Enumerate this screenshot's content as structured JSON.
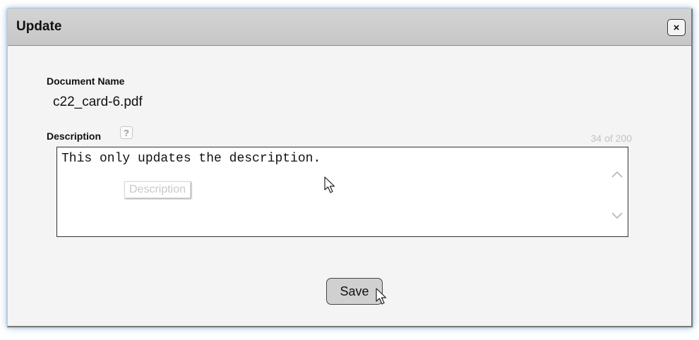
{
  "dialog": {
    "title": "Update",
    "close_label": "×"
  },
  "document": {
    "label": "Document Name",
    "value": "c22_card-6.pdf"
  },
  "description": {
    "label": "Description",
    "help_label": "?",
    "counter": "34 of 200",
    "value": "This only updates the description.",
    "tooltip": "Description"
  },
  "actions": {
    "save_label": "Save"
  },
  "icons": {
    "close": "close-icon",
    "help": "help-icon",
    "scroll_up": "chevron-up-icon",
    "scroll_down": "chevron-down-icon",
    "cursor": "mouse-pointer-icon"
  }
}
